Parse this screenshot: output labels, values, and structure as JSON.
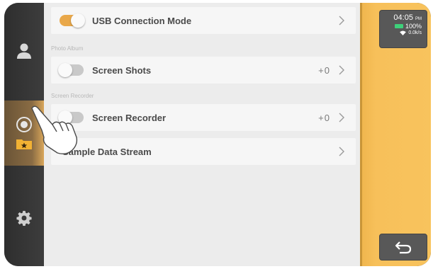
{
  "sidebar": {
    "items": [
      {
        "name": "user",
        "icon": "user-icon"
      },
      {
        "name": "records",
        "icon": "record-icon",
        "active": true,
        "sub_icon": "star-folder-icon"
      },
      {
        "name": "settings",
        "icon": "gear-icon"
      }
    ]
  },
  "main": {
    "usb": {
      "label": "USB Connection Mode",
      "enabled": true
    },
    "photo_album": {
      "section_label": "Photo Album",
      "row": {
        "label": "Screen Shots",
        "count": "+0",
        "enabled": false
      }
    },
    "screen_recorder": {
      "section_label": "Screen Recorder",
      "row": {
        "label": "Screen Recorder",
        "count": "+0",
        "enabled": false
      }
    },
    "sample_stream": {
      "label": "Sample Data Stream"
    }
  },
  "status": {
    "time": "04:05",
    "ampm": "PM",
    "battery": "100%",
    "network": "0.0k/s"
  },
  "colors": {
    "accent": "#f8c35d",
    "toggle_on": "#e9a84a",
    "battery": "#3ed07a"
  }
}
